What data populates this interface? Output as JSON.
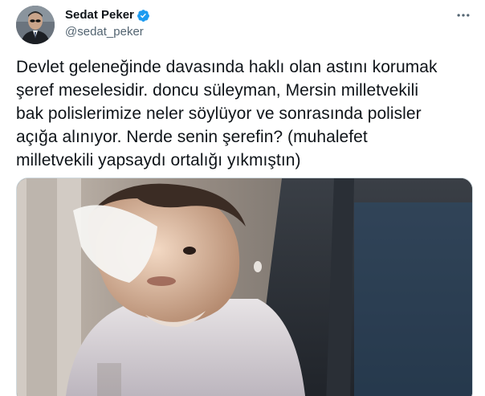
{
  "author": {
    "display_name": "Sedat Peker",
    "handle": "@sedat_peker",
    "verified": true,
    "avatar_icon": "profile-photo"
  },
  "tweet": {
    "text": "Devlet geleneğinde davasında haklı olan astını korumak\nşeref meselesidir. doncu süleyman, Mersin milletvekili\nbak polislerimize neler söylüyor ve sonrasında polisler\naçığa alınıyor. Nerde senin şerefin? (muhalefet\nmilletvekili yapsaydı ortalığı yıkmıştın)"
  },
  "icons": {
    "more": "more-horizontal-icon",
    "verified": "verified-badge-icon"
  },
  "colors": {
    "text_primary": "#0f1419",
    "text_secondary": "#536471",
    "verified_blue": "#1d9bf0",
    "border": "#cfd9de"
  }
}
